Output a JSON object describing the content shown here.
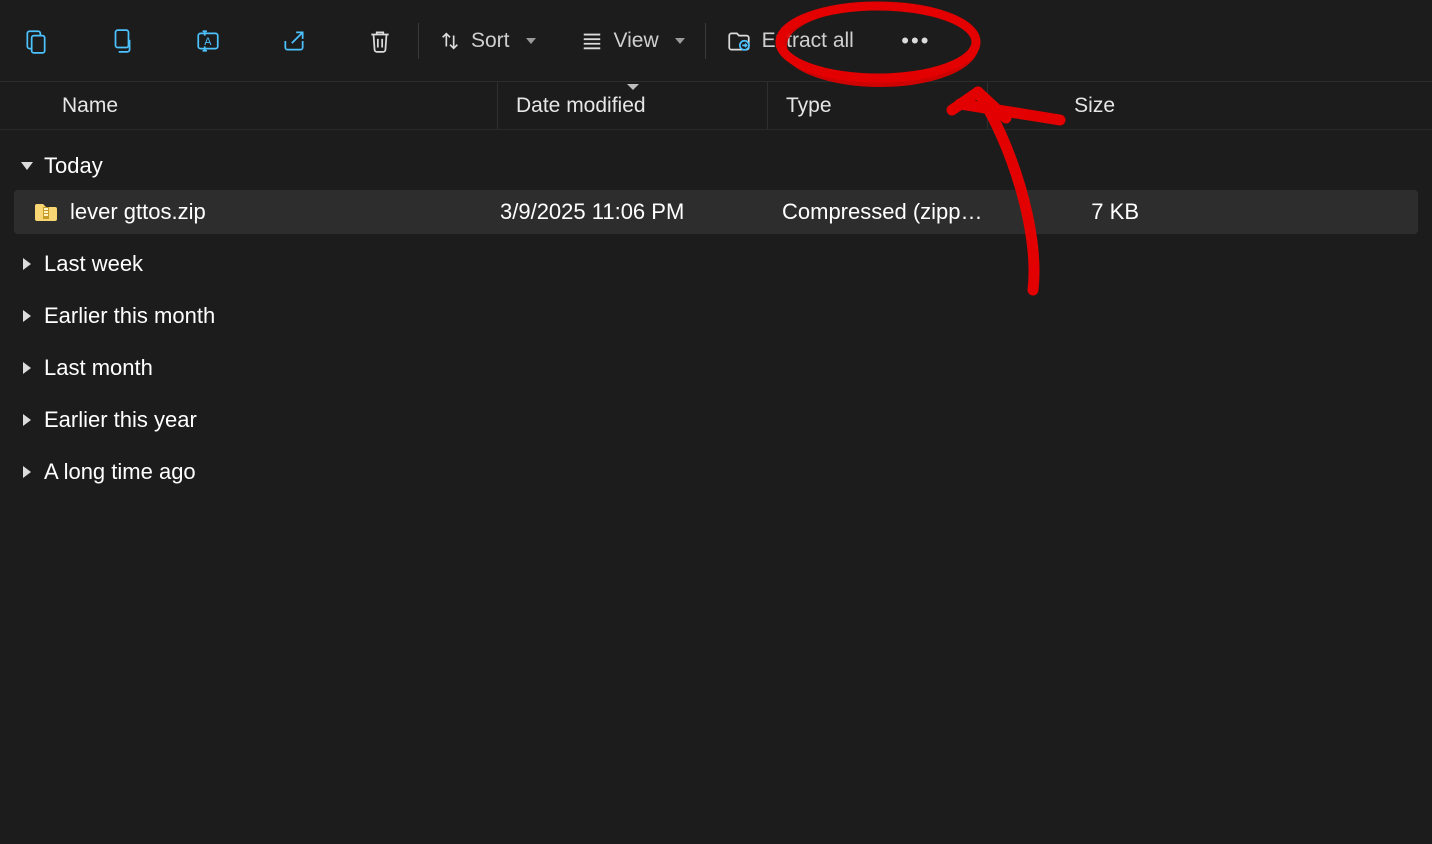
{
  "toolbar": {
    "sort_label": "Sort",
    "view_label": "View",
    "extract_label": "Extract all"
  },
  "columns": {
    "name": "Name",
    "date": "Date modified",
    "type": "Type",
    "size": "Size"
  },
  "groups": [
    {
      "label": "Today",
      "expanded": true
    },
    {
      "label": "Last week",
      "expanded": false
    },
    {
      "label": "Earlier this month",
      "expanded": false
    },
    {
      "label": "Last month",
      "expanded": false
    },
    {
      "label": "Earlier this year",
      "expanded": false
    },
    {
      "label": "A long time ago",
      "expanded": false
    }
  ],
  "file": {
    "name": "lever gttos.zip",
    "date": "3/9/2025 11:06 PM",
    "type": "Compressed (zipp…",
    "size": "7 KB"
  }
}
